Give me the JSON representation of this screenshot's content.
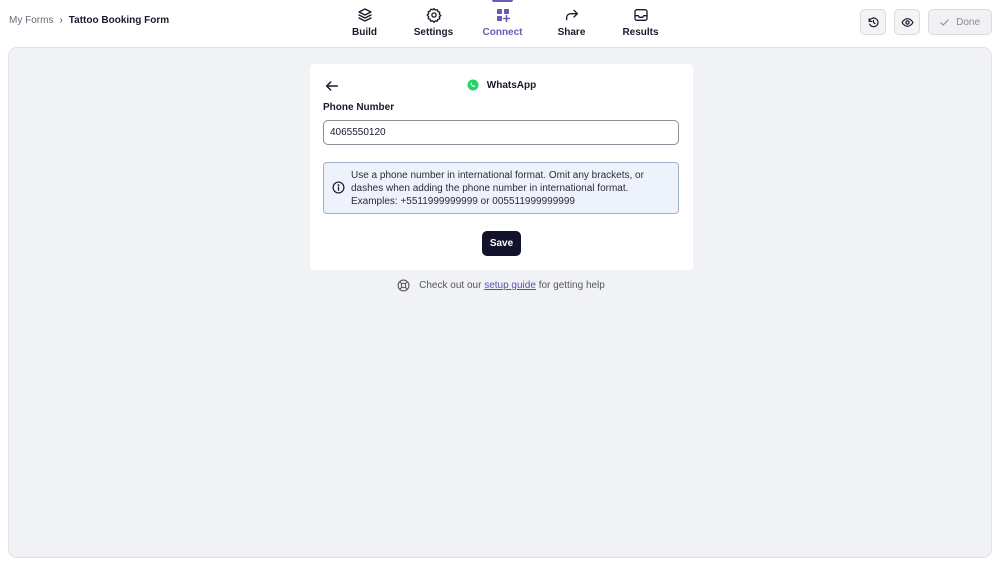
{
  "breadcrumb": {
    "root": "My Forms",
    "separator": "›",
    "current": "Tattoo Booking Form"
  },
  "nav": {
    "build": "Build",
    "settings": "Settings",
    "connect": "Connect",
    "share": "Share",
    "results": "Results",
    "active": "connect",
    "accent_color": "#6a5ab8"
  },
  "actions": {
    "done_label": "Done"
  },
  "integration": {
    "title": "WhatsApp",
    "icon": "whatsapp-icon",
    "icon_color": "#25D366",
    "phone_label": "Phone Number",
    "phone_value": "4065550120",
    "info": {
      "line1": "Use a phone number in international format. Omit any brackets, or",
      "line2": "dashes when adding the phone number in international format.",
      "line3": "Examples: +5511999999999 or 005511999999999"
    },
    "save_label": "Save"
  },
  "help": {
    "prefix": "Check out our",
    "link": "setup guide",
    "suffix": "for getting help"
  }
}
